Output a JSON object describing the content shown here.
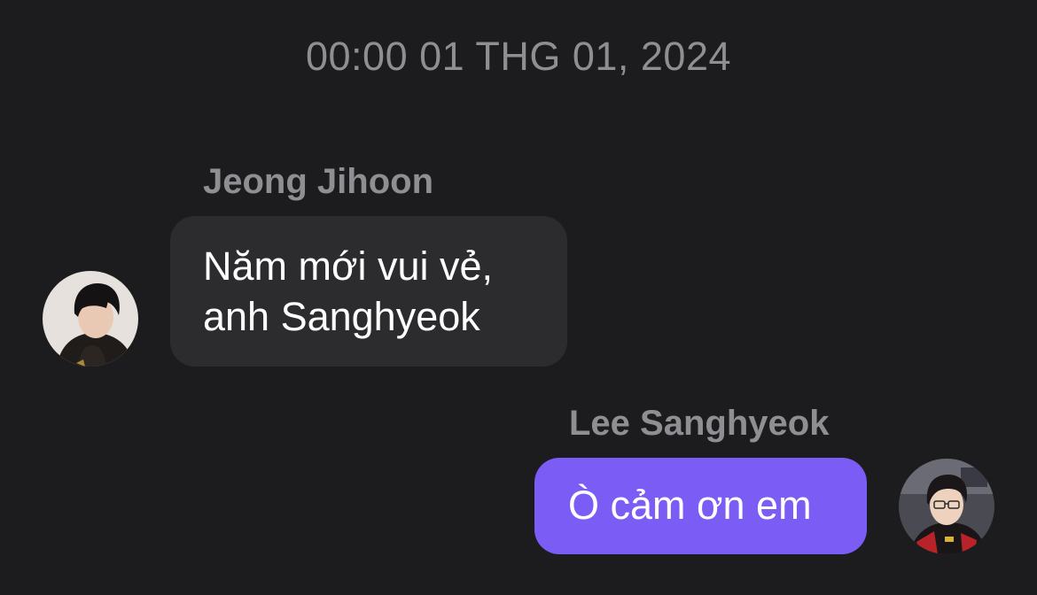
{
  "chat": {
    "timestamp": "00:00 01 THG 01, 2024",
    "messages": [
      {
        "sender": "Jeong Jihoon",
        "side": "left",
        "lines": [
          "Năm mới vui vẻ,",
          "anh Sanghyeok"
        ],
        "bubble_color": "#2c2c2e",
        "avatar_icon": "profile-photo-jeong-jihoon"
      },
      {
        "sender": "Lee Sanghyeok",
        "side": "right",
        "text": "Ò cảm ơn em",
        "bubble_color": "#7b5cf5",
        "avatar_icon": "profile-photo-lee-sanghyeok"
      }
    ]
  },
  "colors": {
    "background": "#1c1c1e",
    "secondary_text": "#8e8e93",
    "accent": "#7b5cf5"
  }
}
